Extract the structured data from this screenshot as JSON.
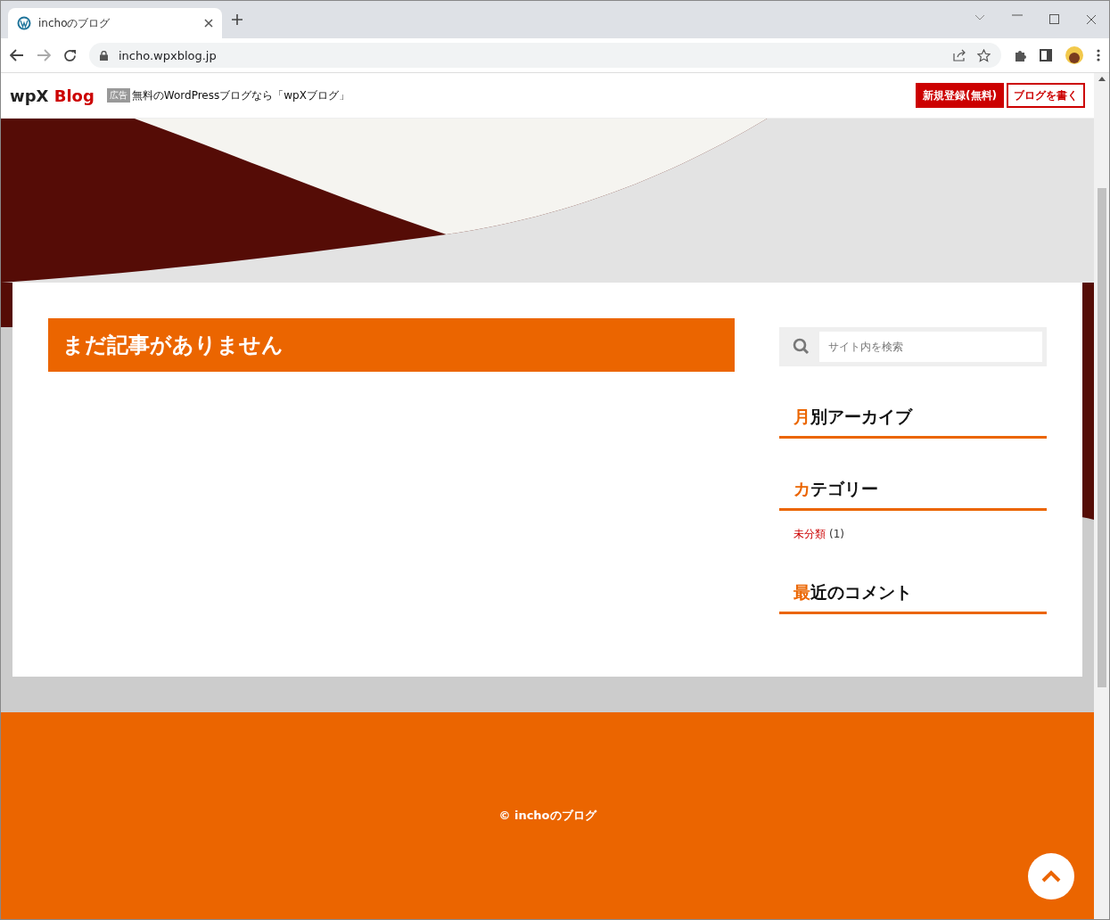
{
  "browser": {
    "tab_title": "inchoのブログ",
    "url": "incho.wpxblog.jp"
  },
  "ad_bar": {
    "logo_main": "wpX",
    "logo_accent": "Blog",
    "ad_label": "広告",
    "ad_text": "無料のWordPressブログなら「wpXブログ」",
    "buttons": [
      {
        "label": "新規登録(無料)",
        "kind": "filled"
      },
      {
        "label": "ブログを書く",
        "kind": "outline"
      }
    ]
  },
  "main": {
    "notice": "まだ記事がありません"
  },
  "sidebar": {
    "search": {
      "placeholder": "サイト内を検索"
    },
    "widgets": [
      {
        "accent": "月",
        "title": "別アーカイブ"
      },
      {
        "accent": "カ",
        "title": "テゴリー",
        "links": [
          {
            "label": "未分類",
            "count": "(1)"
          }
        ]
      },
      {
        "accent": "最",
        "title": "近のコメント"
      }
    ]
  },
  "footer": {
    "copyright": "© inchoのブログ"
  }
}
